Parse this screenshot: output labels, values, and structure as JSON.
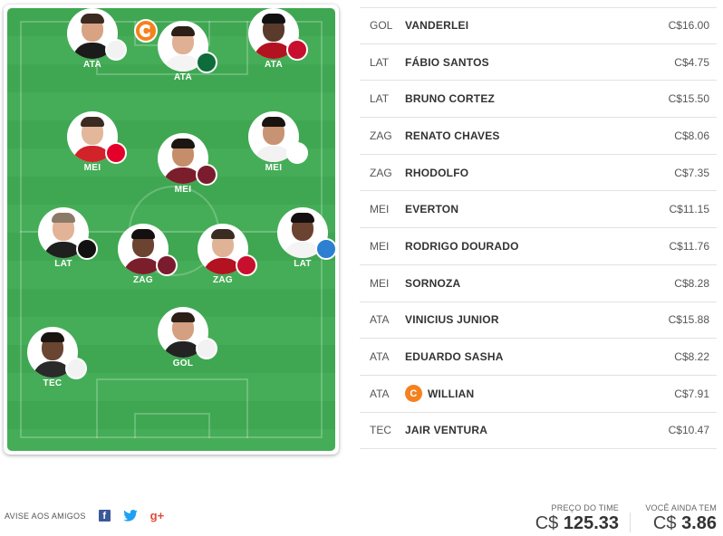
{
  "field": {
    "players": [
      {
        "id": "p1",
        "pos": "ATA",
        "crest": "SAN",
        "crest_color": "#f2f2f2",
        "crest_text_color": "#111",
        "shirt": "#1b1b1b",
        "hair": "#3a2a20",
        "skin": "#d7a383",
        "captain": false
      },
      {
        "id": "p2",
        "pos": "ATA",
        "crest": "PAL",
        "crest_color": "#0e6b3a",
        "crest_text_color": "#fff",
        "shirt": "#f4f4f4",
        "hair": "#2c1f18",
        "skin": "#e0b094",
        "captain": true
      },
      {
        "id": "p3",
        "pos": "ATA",
        "crest": "FLA",
        "crest_color": "#c8102e",
        "crest_text_color": "#fff",
        "shirt": "#b31220",
        "hair": "#111111",
        "skin": "#5a3b2b",
        "captain": false
      },
      {
        "id": "p4",
        "pos": "MEI",
        "crest": "INT",
        "crest_color": "#e4002b",
        "crest_text_color": "#fff",
        "shirt": "#d2232a",
        "hair": "#3b2b22",
        "skin": "#e3b79a",
        "captain": false
      },
      {
        "id": "p5",
        "pos": "MEI",
        "crest": "FLU",
        "crest_color": "#7a1c2e",
        "crest_text_color": "#fff",
        "shirt": "#7b1e2c",
        "hair": "#1c1612",
        "skin": "#c58d6a",
        "captain": false
      },
      {
        "id": "p6",
        "pos": "MEI",
        "crest": "SPFC",
        "crest_color": "#ffffff",
        "crest_text_color": "#c8102e",
        "shirt": "#f2f2f2",
        "hair": "#1a1410",
        "skin": "#c89373",
        "captain": false
      },
      {
        "id": "p7",
        "pos": "LAT",
        "crest": "CAM",
        "crest_color": "#111111",
        "crest_text_color": "#fff",
        "shirt": "#1f1f1f",
        "hair": "#8c7a68",
        "skin": "#e2b396",
        "captain": false
      },
      {
        "id": "p8",
        "pos": "ZAG",
        "crest": "FLU",
        "crest_color": "#7a1c2e",
        "crest_text_color": "#fff",
        "shirt": "#7b1e2c",
        "hair": "#141010",
        "skin": "#6b4330",
        "captain": false
      },
      {
        "id": "p9",
        "pos": "ZAG",
        "crest": "FLA",
        "crest_color": "#c8102e",
        "crest_text_color": "#fff",
        "shirt": "#b31220",
        "hair": "#3a2c22",
        "skin": "#e0b397",
        "captain": false
      },
      {
        "id": "p10",
        "pos": "LAT",
        "crest": "GRE",
        "crest_color": "#2c7fd1",
        "crest_text_color": "#fff",
        "shirt": "#f4f4f4",
        "hair": "#141010",
        "skin": "#6b4330",
        "captain": false
      },
      {
        "id": "p11",
        "pos": "GOL",
        "crest": "SAN",
        "crest_color": "#f2f2f2",
        "crest_text_color": "#111",
        "shirt": "#232323",
        "hair": "#2b1f18",
        "skin": "#d4a081",
        "captain": false
      },
      {
        "id": "p12",
        "pos": "TEC",
        "crest": "SAN",
        "crest_color": "#f2f2f2",
        "crest_text_color": "#111",
        "shirt": "#2a2a2a",
        "hair": "#1a1410",
        "skin": "#6a4532",
        "captain": false
      }
    ],
    "captain_glyph": "C"
  },
  "squad": [
    {
      "pos": "GOL",
      "name": "VANDERLEI",
      "price": "C$16.00",
      "captain": false
    },
    {
      "pos": "LAT",
      "name": "FÁBIO SANTOS",
      "price": "C$4.75",
      "captain": false
    },
    {
      "pos": "LAT",
      "name": "BRUNO CORTEZ",
      "price": "C$15.50",
      "captain": false
    },
    {
      "pos": "ZAG",
      "name": "RENATO CHAVES",
      "price": "C$8.06",
      "captain": false
    },
    {
      "pos": "ZAG",
      "name": "RHODOLFO",
      "price": "C$7.35",
      "captain": false
    },
    {
      "pos": "MEI",
      "name": "EVERTON",
      "price": "C$11.15",
      "captain": false
    },
    {
      "pos": "MEI",
      "name": "RODRIGO DOURADO",
      "price": "C$11.76",
      "captain": false
    },
    {
      "pos": "MEI",
      "name": "SORNOZA",
      "price": "C$8.28",
      "captain": false
    },
    {
      "pos": "ATA",
      "name": "VINICIUS JUNIOR",
      "price": "C$15.88",
      "captain": false
    },
    {
      "pos": "ATA",
      "name": "EDUARDO SASHA",
      "price": "C$8.22",
      "captain": false
    },
    {
      "pos": "ATA",
      "name": "WILLIAN",
      "price": "C$7.91",
      "captain": true
    },
    {
      "pos": "TEC",
      "name": "JAIR VENTURA",
      "price": "C$10.47",
      "captain": false
    }
  ],
  "footer": {
    "share_label": "AVISE AOS AMIGOS",
    "facebook_glyph": "f",
    "twitter_glyph": "🐦",
    "googleplus_glyph": "g+",
    "team_price_label": "PREÇO DO TIME",
    "team_price_currency": "C$",
    "team_price_value": "125.33",
    "remaining_label": "VOCÊ AINDA TEM",
    "remaining_currency": "C$",
    "remaining_value": "3.86"
  }
}
